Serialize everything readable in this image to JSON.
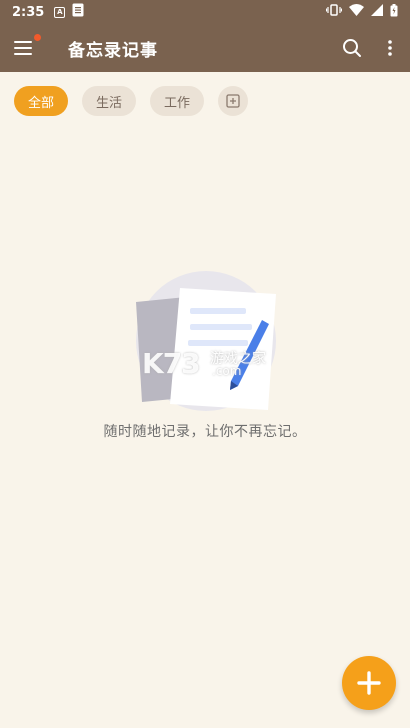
{
  "status_bar": {
    "time": "2:35",
    "badge_a": "A"
  },
  "app_bar": {
    "title": "备忘录记事"
  },
  "tabs": [
    {
      "label": "全部",
      "active": true
    },
    {
      "label": "生活",
      "active": false
    },
    {
      "label": "工作",
      "active": false
    }
  ],
  "empty_state": {
    "message": "随时随地记录，让你不再忘记。",
    "watermark_main": "K73",
    "watermark_site": "游戏之家",
    "watermark_domain": ".com"
  },
  "colors": {
    "app_bar": "#7a624f",
    "accent": "#f0a020",
    "fab": "#f5a01a",
    "background": "#f9f4ea"
  },
  "icons": [
    "menu-icon",
    "search-icon",
    "more-vert-icon",
    "add-category-icon",
    "plus-icon"
  ]
}
